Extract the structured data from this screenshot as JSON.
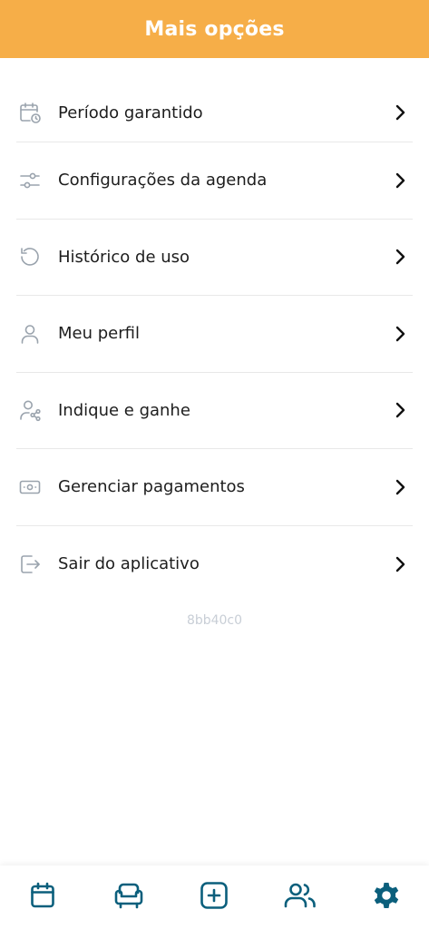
{
  "header": {
    "title": "Mais opções"
  },
  "menu": {
    "items": [
      {
        "label": "Período garantido",
        "icon": "calendar-clock-icon"
      },
      {
        "label": "Configurações da agenda",
        "icon": "sliders-icon"
      },
      {
        "label": "Histórico de uso",
        "icon": "history-icon"
      },
      {
        "label": "Meu perfil",
        "icon": "user-icon"
      },
      {
        "label": "Indique e ganhe",
        "icon": "user-share-icon"
      },
      {
        "label": "Gerenciar pagamentos",
        "icon": "banknote-icon"
      },
      {
        "label": "Sair do aplicativo",
        "icon": "logout-icon"
      }
    ]
  },
  "version": "8bb40c0",
  "bottom_nav": {
    "items": [
      {
        "icon": "calendar-icon",
        "active": false
      },
      {
        "icon": "armchair-icon",
        "active": false
      },
      {
        "icon": "plus-square-icon",
        "active": false
      },
      {
        "icon": "users-icon",
        "active": false
      },
      {
        "icon": "gear-icon",
        "active": true
      }
    ]
  },
  "colors": {
    "header": "#f6ae48",
    "nav_icon": "#0b5f7c",
    "menu_icon": "#9aa3ad",
    "text": "#1d1d1d",
    "version": "#c8ced6"
  }
}
